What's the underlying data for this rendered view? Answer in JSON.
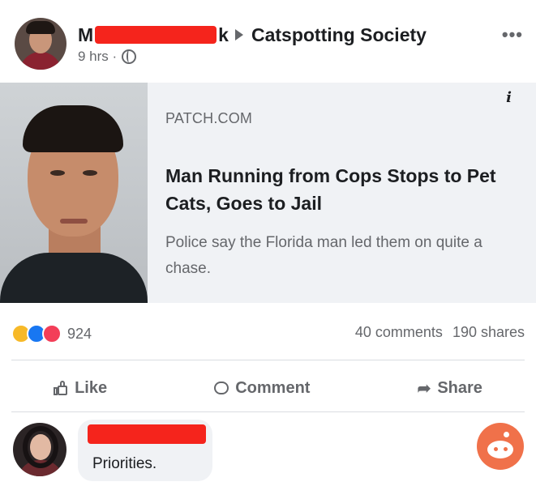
{
  "post": {
    "author_initial": "M",
    "author_tail": "k",
    "group": "Catspotting Society",
    "time": "9 hrs ·",
    "privacy_icon": "globe-icon",
    "more_icon": "more-options-icon"
  },
  "link": {
    "domain": "PATCH.COM",
    "title": "Man Running from Cops Stops to Pet Cats, Goes to Jail",
    "description": "Police say the Florida man led them on quite a chase.",
    "info_icon": "i"
  },
  "stats": {
    "reaction_icons": [
      "haha-icon",
      "like-icon",
      "love-icon"
    ],
    "reaction_count": "924",
    "comments": "40 comments",
    "shares": "190 shares"
  },
  "actions": {
    "like": "Like",
    "comment": "Comment",
    "share": "Share"
  },
  "comment": {
    "text": "Priorities."
  },
  "colors": {
    "redaction": "#f5241c",
    "card_bg": "#f0f2f5",
    "secondary_text": "#65676b",
    "reddit": "#f0714a"
  }
}
